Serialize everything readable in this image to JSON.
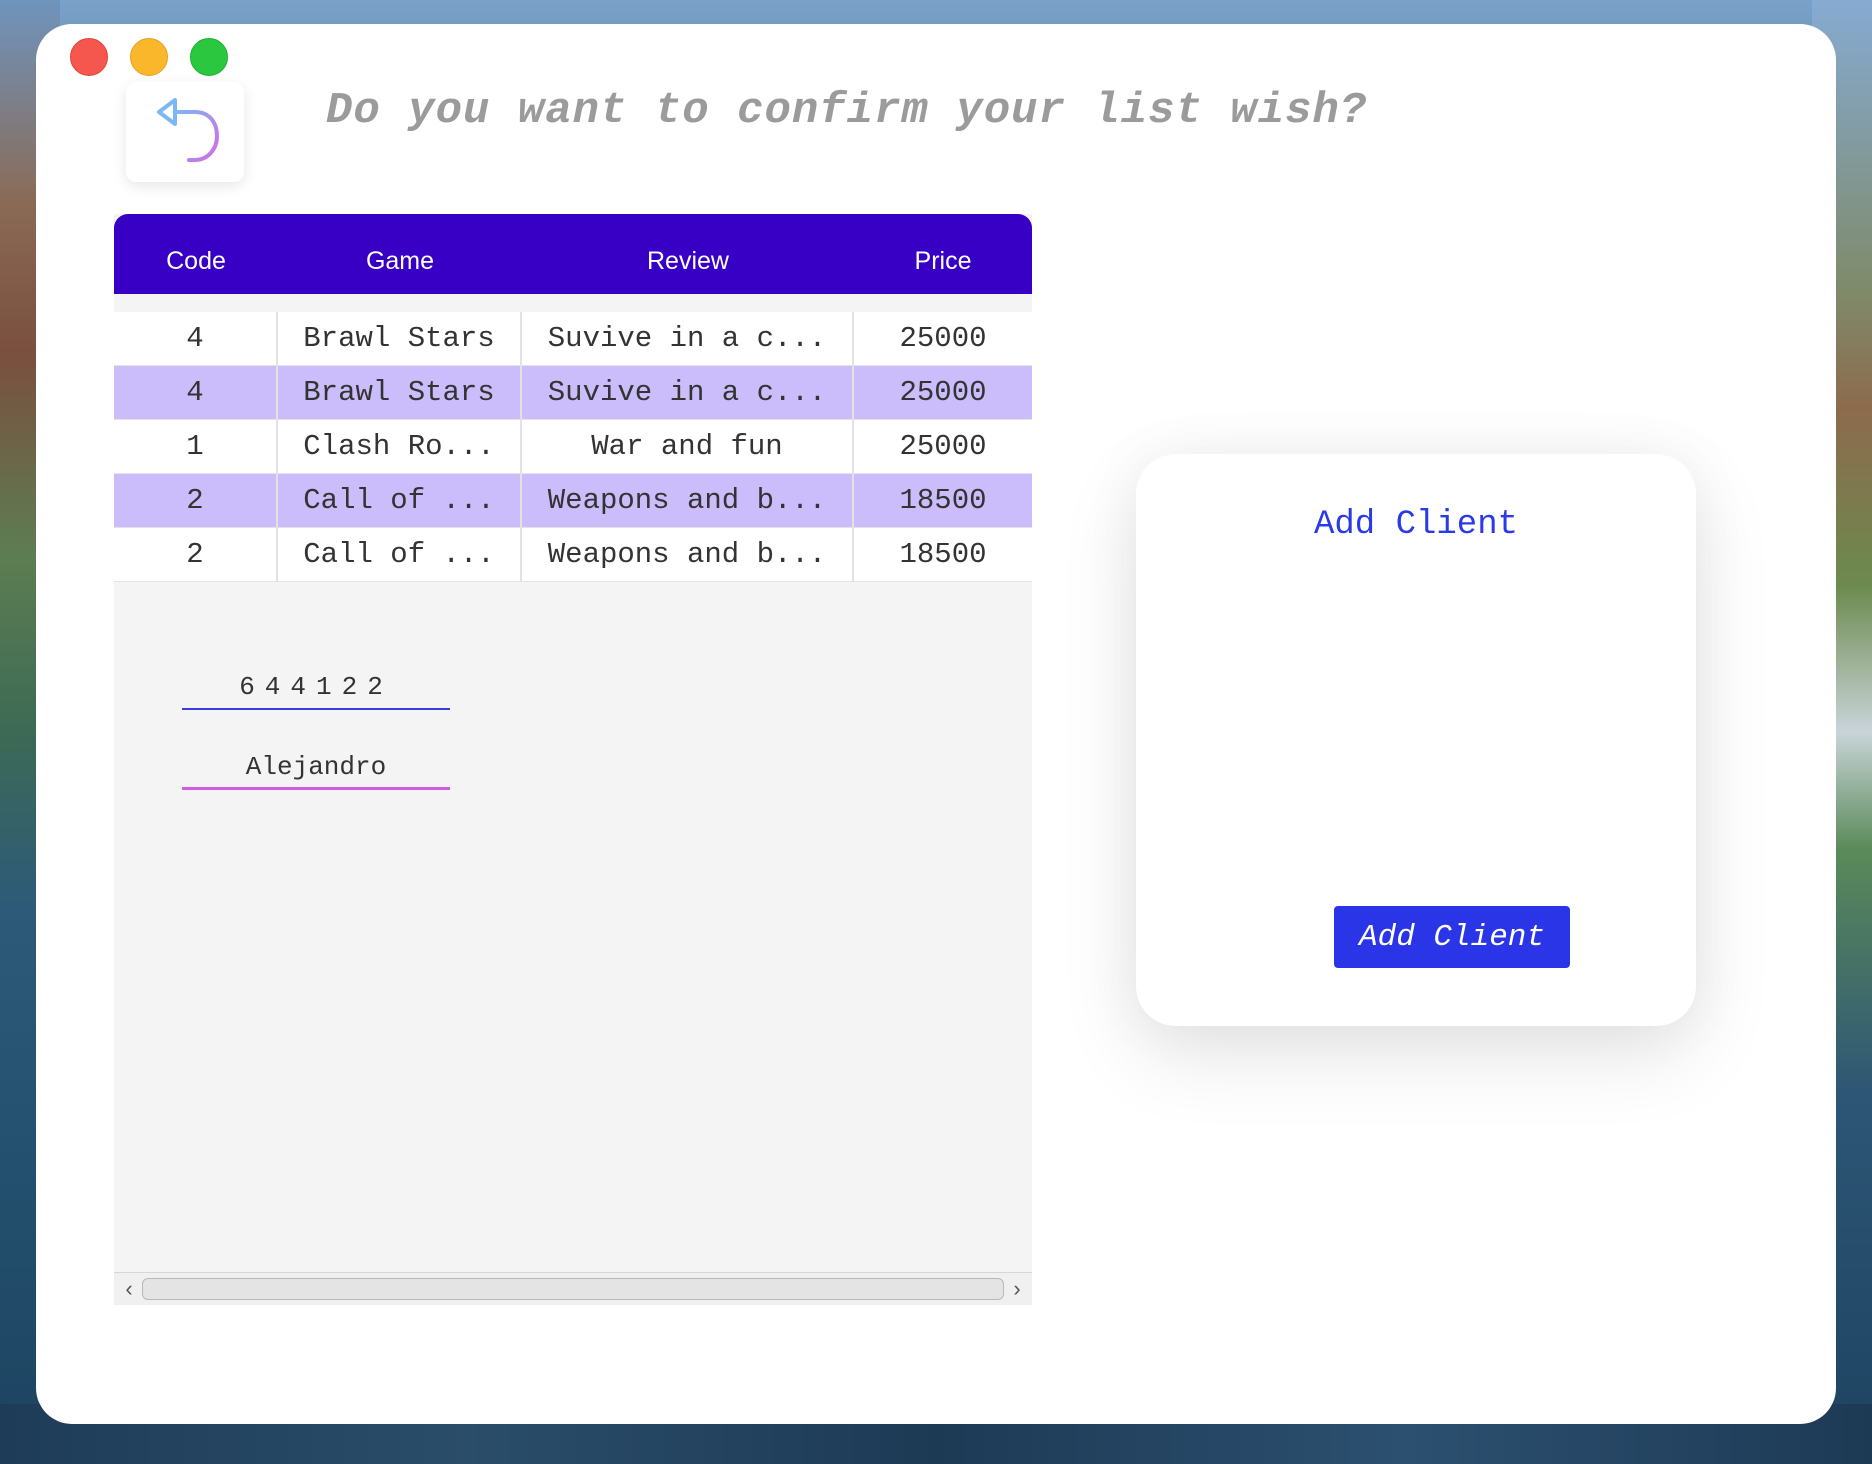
{
  "header": {
    "title": "Do you want to confirm your list wish?"
  },
  "table": {
    "columns": [
      "Code",
      "Game",
      "Review",
      "Price"
    ],
    "rows": [
      {
        "code": "4",
        "game": "Brawl Stars",
        "review": "Suvive in a c...",
        "price": "25000"
      },
      {
        "code": "4",
        "game": "Brawl Stars",
        "review": "Suvive in a c...",
        "price": "25000"
      },
      {
        "code": "1",
        "game": "Clash Ro...",
        "review": "War and fun",
        "price": "25000"
      },
      {
        "code": "2",
        "game": "Call of ...",
        "review": "Weapons and b...",
        "price": "18500"
      },
      {
        "code": "2",
        "game": "Call of ...",
        "review": "Weapons and b...",
        "price": "18500"
      }
    ]
  },
  "form": {
    "title": "Add Client",
    "id_value": "644122",
    "name_value": "Alejandro",
    "submit_label": "Add Client"
  },
  "icons": {
    "back": "undo-arrow-icon",
    "scroll_left": "chevron-left-icon",
    "scroll_right": "chevron-right-icon"
  },
  "colors": {
    "header_bg": "#3700c4",
    "row_alt": "#cbbcfb",
    "accent": "#2a35e8",
    "close": "#f5564e",
    "minimize": "#fbb72c",
    "maximize": "#2ac73f"
  }
}
